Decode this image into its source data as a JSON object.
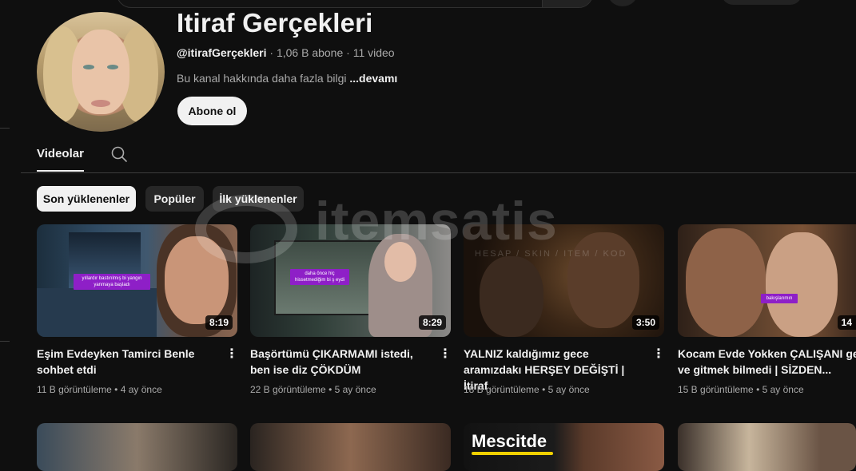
{
  "channel": {
    "name": "Itiraf Gerçekleri",
    "handle": "@itirafGerçekleri",
    "meta_sep1": " · ",
    "subscribers": "1,06 B abone",
    "meta_sep2": " · ",
    "video_count": "11 video",
    "description": "Bu kanal hakkında daha fazla bilgi ",
    "more_label": "...devamı",
    "subscribe_label": "Abone ol"
  },
  "tabs": {
    "videos_label": "Videolar"
  },
  "chips": [
    {
      "label": "Son yüklenenler",
      "active": true
    },
    {
      "label": "Popüler",
      "active": false
    },
    {
      "label": "İlk yüklenenler",
      "active": false
    }
  ],
  "videos": [
    {
      "title": "Eşim Evdeyken Tamirci Benle sohbet etdi",
      "views": "11 B görüntüleme",
      "age": "4 ay önce",
      "duration": "8:19",
      "overlay": "yıllardır bastırılmış bi yangın yanmaya başladı"
    },
    {
      "title": "Başörtümü ÇIKARMAMI istedi, ben ise diz ÇÖKDÜM",
      "views": "22 B görüntüleme",
      "age": "5 ay önce",
      "duration": "8:29",
      "overlay": "daha önce hiç hissetmediğim bi ş eydi"
    },
    {
      "title": "YALNIZ kaldığımız gece aramızdakı HERŞEY DEĞİŞTİ | İtiraf",
      "views": "18 B görüntüleme",
      "age": "5 ay önce",
      "duration": "3:50",
      "overlay": ""
    },
    {
      "title": "Kocam Evde Yokken ÇALIŞANI geldi ve gitmek bilmedi | SİZDEN...",
      "views": "15 B görüntüleme",
      "age": "5 ay önce",
      "duration": "14",
      "overlay": "bakışlarımın"
    }
  ],
  "row2": {
    "thumb3_text": "Mescitde"
  },
  "meta_dot": " • ",
  "menu_glyph": "⋮",
  "colors": {
    "background": "#0f0f0f",
    "text": "#f1f1f1",
    "secondary_text": "#aaaaaa",
    "chip_bg": "#272727",
    "overlay_label": "#8e1fc7"
  }
}
